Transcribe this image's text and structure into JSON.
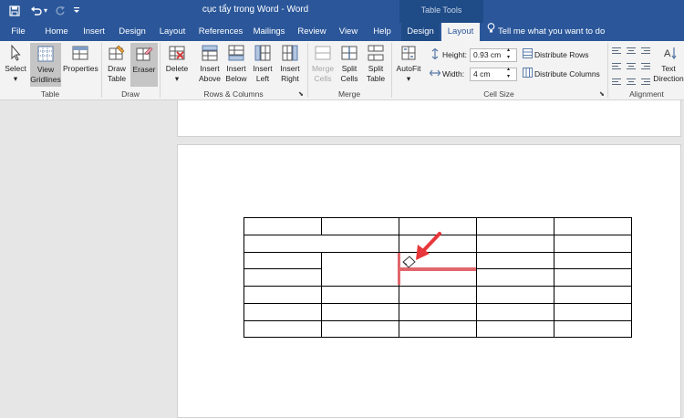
{
  "window": {
    "title": "cục tẩy trong Word  -  Word",
    "context_label": "Table Tools"
  },
  "qat": {
    "undo_arrow": "▾"
  },
  "tabs": [
    "File",
    "Home",
    "Insert",
    "Design",
    "Layout",
    "References",
    "Mailings",
    "Review",
    "View",
    "Help",
    "Design",
    "Layout"
  ],
  "tell_me": "Tell me what you want to do",
  "ribbon": {
    "table": {
      "select": "Select",
      "view_gridlines": "View Gridlines",
      "properties": "Properties",
      "group": "Table"
    },
    "draw": {
      "draw_table": "Draw Table",
      "eraser": "Eraser",
      "group": "Draw"
    },
    "rows_columns": {
      "delete": "Delete",
      "insert_above": "Insert Above",
      "insert_below": "Insert Below",
      "insert_left": "Insert Left",
      "insert_right": "Insert Right",
      "group": "Rows & Columns"
    },
    "merge": {
      "merge_cells": "Merge Cells",
      "split_cells": "Split Cells",
      "split_table": "Split Table",
      "group": "Merge"
    },
    "cell_size": {
      "autofit": "AutoFit",
      "height_label": "Height:",
      "height_value": "0.93 cm",
      "width_label": "Width:",
      "width_value": "4 cm",
      "distribute_rows": "Distribute Rows",
      "distribute_columns": "Distribute Columns",
      "group": "Cell Size"
    },
    "alignment": {
      "text_direction": "Text Direction",
      "group": "Alignment"
    }
  },
  "document": {
    "table": {
      "rows": 7,
      "columns": 5,
      "cells": []
    }
  },
  "colors": {
    "brand": "#2b579a",
    "context_tab": "#1f4b87",
    "highlight": "#e0666b",
    "ribbon_bg": "#f3f3f3"
  }
}
